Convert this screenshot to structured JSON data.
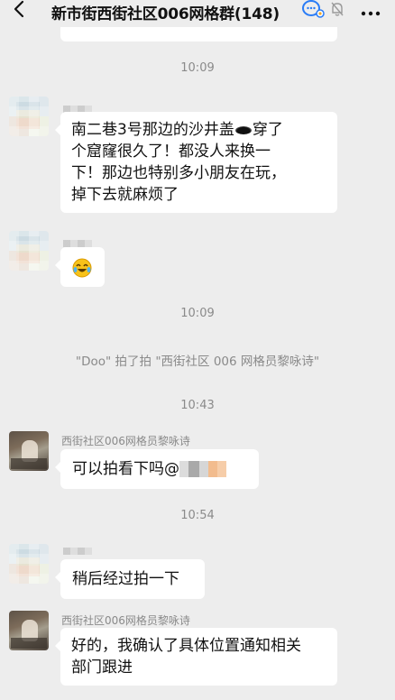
{
  "header": {
    "title": "新市街西街社区006网格群(148)",
    "back_icon": "chevron-left-icon",
    "chat_icon": "chat-bubbles-icon",
    "mute_icon": "bell-off-icon",
    "more_icon": "more-dots-icon"
  },
  "messages": {
    "t1": "10:09",
    "m1_text_a": "南二巷3号那边的沙井盖",
    "m1_text_b": "穿了",
    "m1_text_c": "个窟窿很久了！都没人来换一",
    "m1_text_d": "下！那边也特别多小朋友在玩，",
    "m1_text_e": "掉下去就麻烦了",
    "m2_emoji": "laughing-tears-emoji",
    "t2": "10:09",
    "sys1": "\"Doo\" 拍了拍 \"西街社区 006 网格员黎咏诗\"",
    "t3": "10:43",
    "m3_nick": "西街社区006网格员黎咏诗",
    "m3_text": "可以拍看下吗@",
    "t4": "10:54",
    "m4_text": "稍后经过拍一下",
    "m5_nick": "西街社区006网格员黎咏诗",
    "m5_text_a": "好的，我确认了具体位置通知相关",
    "m5_text_b": "部门跟进"
  },
  "colors": {
    "background": "#ededed",
    "bubble": "#ffffff",
    "meta_text": "#8a8a8a",
    "title_text": "#111111"
  }
}
